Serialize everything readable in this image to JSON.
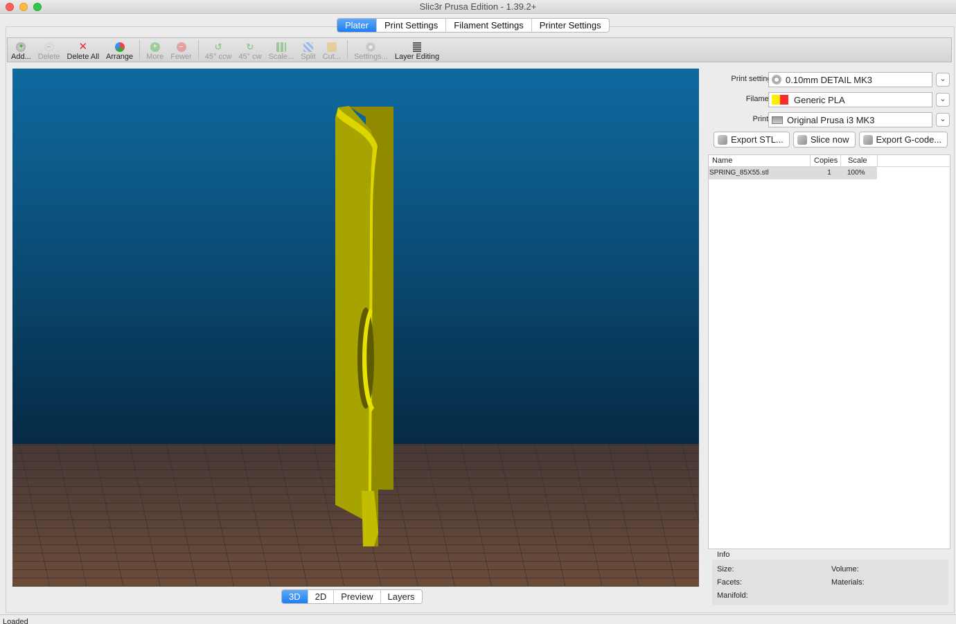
{
  "window": {
    "title": "Slic3r Prusa Edition - 1.39.2+"
  },
  "main_tabs": [
    {
      "label": "Plater",
      "active": true
    },
    {
      "label": "Print Settings",
      "active": false
    },
    {
      "label": "Filament Settings",
      "active": false
    },
    {
      "label": "Printer Settings",
      "active": false
    }
  ],
  "toolbar": {
    "add": "Add...",
    "delete": "Delete",
    "delete_all": "Delete All",
    "arrange": "Arrange",
    "more": "More",
    "fewer": "Fewer",
    "rotate_ccw": "45° ccw",
    "rotate_cw": "45° cw",
    "scale": "Scale...",
    "split": "Split",
    "cut": "Cut...",
    "settings": "Settings...",
    "layer_editing": "Layer Editing"
  },
  "view_tabs": [
    {
      "label": "3D",
      "active": true
    },
    {
      "label": "2D",
      "active": false
    },
    {
      "label": "Preview",
      "active": false
    },
    {
      "label": "Layers",
      "active": false
    }
  ],
  "presets": {
    "print_label": "Print settings:",
    "print_value": "0.10mm DETAIL MK3",
    "filament_label": "Filament:",
    "filament_value": "Generic PLA",
    "filament_colors": [
      "#ffee00",
      "#ff2a2a"
    ],
    "printer_label": "Printer:",
    "printer_value": "Original Prusa i3 MK3"
  },
  "actions": {
    "export_stl": "Export STL...",
    "slice_now": "Slice now",
    "export_gcode": "Export G-code..."
  },
  "object_list": {
    "headers": {
      "name": "Name",
      "copies": "Copies",
      "scale": "Scale"
    },
    "rows": [
      {
        "name": "SPRING_85X55.stl",
        "copies": "1",
        "scale": "100%"
      }
    ]
  },
  "info": {
    "title": "Info",
    "size": "Size:",
    "volume": "Volume:",
    "facets": "Facets:",
    "materials": "Materials:",
    "manifold": "Manifold:"
  },
  "status": "Loaded",
  "colors": {
    "accent": "#1d7ef6",
    "model": "#c9c400",
    "bed": "#6b4c3a",
    "sky": "#0f6aa0"
  }
}
